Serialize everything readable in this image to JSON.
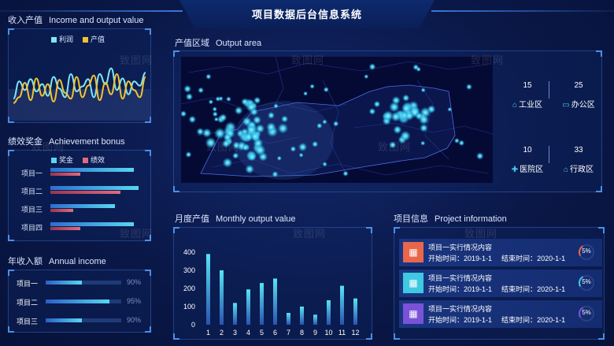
{
  "header": {
    "title": "项目数据后台信息系统"
  },
  "income_output": {
    "title_cn": "收入产值",
    "title_en": "Income and output value",
    "legend": [
      {
        "name": "利润",
        "color": "#7fe6f5"
      },
      {
        "name": "产值",
        "color": "#f1c232"
      }
    ]
  },
  "bonus": {
    "title_cn": "绩效奖金",
    "title_en": "Achievement bonus",
    "legend": [
      {
        "name": "奖金",
        "color": "#58d6f0"
      },
      {
        "name": "绩效",
        "color": "#e06a80"
      }
    ],
    "rows": [
      {
        "label": "项目一",
        "bonus": 0.88,
        "perf": 0.32
      },
      {
        "label": "项目二",
        "bonus": 0.93,
        "perf": 0.74
      },
      {
        "label": "项目三",
        "bonus": 0.68,
        "perf": 0.24
      },
      {
        "label": "项目四",
        "bonus": 0.88,
        "perf": 0.32
      }
    ]
  },
  "annual_income": {
    "title_cn": "年收入额",
    "title_en": "Annual income",
    "rows": [
      {
        "label": "项目一",
        "value": 0.48,
        "pct": "90%"
      },
      {
        "label": "项目二",
        "value": 0.84,
        "pct": "95%"
      },
      {
        "label": "项目三",
        "value": 0.48,
        "pct": "90%"
      }
    ]
  },
  "output_area": {
    "title_cn": "产值区域",
    "title_en": "Output area",
    "stats": [
      {
        "value": "15",
        "label": "工业区",
        "icon": "factory-icon"
      },
      {
        "value": "25",
        "label": "办公区",
        "icon": "office-icon"
      },
      {
        "value": "10",
        "label": "医院区",
        "icon": "hospital-icon"
      },
      {
        "value": "33",
        "label": "行政区",
        "icon": "admin-icon"
      }
    ]
  },
  "monthly": {
    "title_cn": "月度产值",
    "title_en": "Monthly output value"
  },
  "project_info": {
    "title_cn": "项目信息",
    "title_en": "Project information",
    "cards": [
      {
        "name": "项目一实行情况内容",
        "start_label": "开始时间：",
        "start": "2019-1-1",
        "end_label": "结束时间：",
        "end": "2020-1-1",
        "pct": "5%",
        "pct_value": 0.05,
        "color": "#e8664a"
      },
      {
        "name": "项目一实行情况内容",
        "start_label": "开始时间：",
        "start": "2019-1-1",
        "end_label": "结束时间：",
        "end": "2020-1-1",
        "pct": "5%",
        "pct_value": 0.05,
        "color": "#3fc8e0"
      },
      {
        "name": "项目一实行情况内容",
        "start_label": "开始时间：",
        "start": "2019-1-1",
        "end_label": "结束时间：",
        "end": "2020-1-1",
        "pct": "5%",
        "pct_value": 0.05,
        "color": "#7a52d8"
      }
    ]
  },
  "watermark": "致图网",
  "chart_data": [
    {
      "type": "line",
      "series": [
        {
          "name": "利润",
          "color": "#7fe6f5",
          "values": [
            28,
            52,
            40,
            55,
            38,
            48,
            32,
            58,
            42,
            30,
            62,
            38,
            45,
            55,
            30,
            62,
            48,
            70,
            40,
            56,
            34,
            52,
            46,
            64
          ]
        },
        {
          "name": "产值",
          "color": "#f1c232",
          "values": [
            22,
            30,
            50,
            26,
            56,
            32,
            48,
            24,
            54,
            36,
            28,
            58,
            30,
            46,
            60,
            26,
            50,
            34,
            62,
            28,
            52,
            40,
            30,
            58
          ]
        }
      ],
      "ylim": [
        0,
        100
      ]
    },
    {
      "type": "bar",
      "categories": [
        "1",
        "2",
        "3",
        "4",
        "5",
        "6",
        "7",
        "8",
        "9",
        "10",
        "11",
        "12"
      ],
      "values": [
        390,
        300,
        120,
        195,
        230,
        255,
        65,
        100,
        55,
        135,
        215,
        145
      ],
      "yticks": [
        "0",
        "100",
        "200",
        "300",
        "400"
      ],
      "ylim": [
        0,
        400
      ]
    }
  ]
}
